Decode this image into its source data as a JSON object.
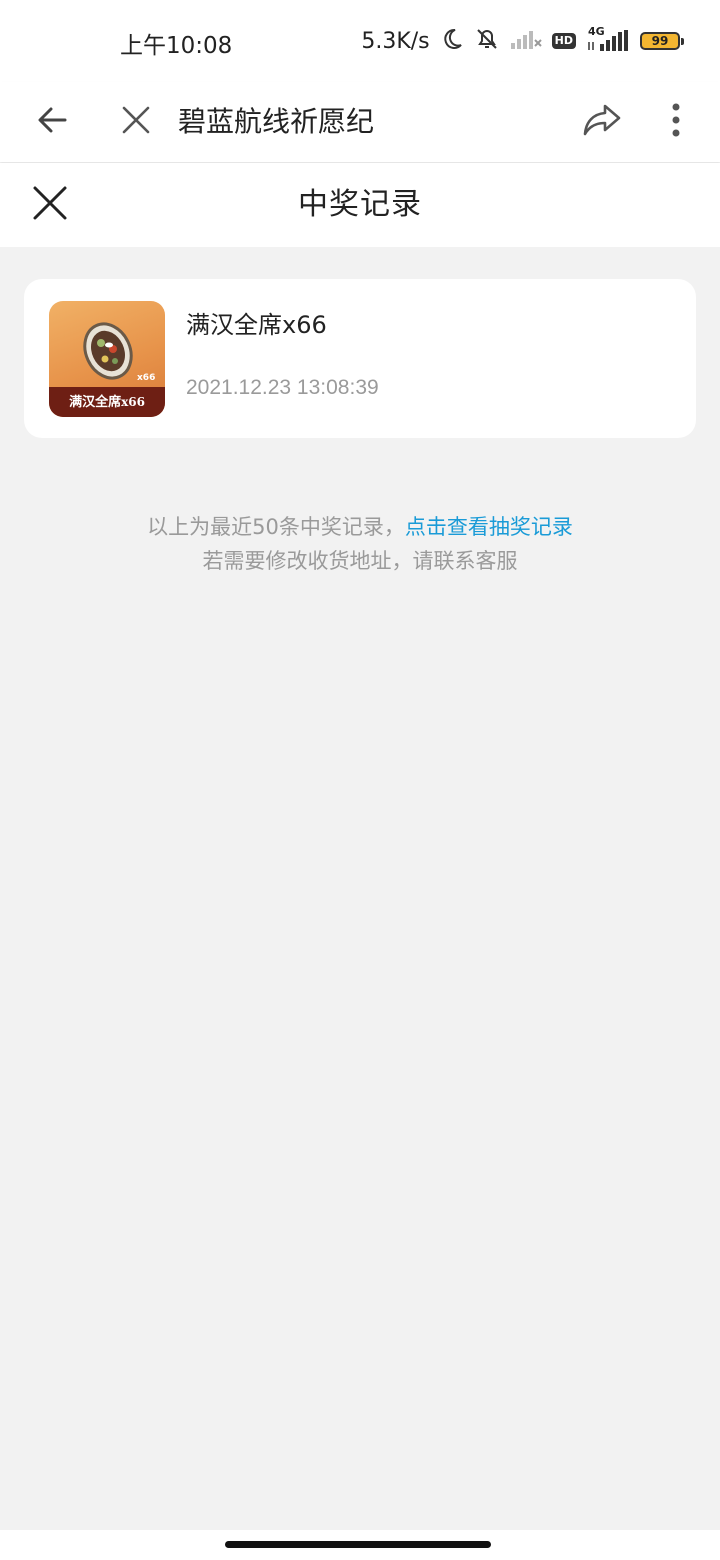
{
  "status_bar": {
    "time": "上午10:08",
    "net_speed": "5.3K/s",
    "network_type": "4G",
    "hd_label": "HD",
    "battery": "99",
    "icons": [
      "moon-icon",
      "mute-bell-icon",
      "wifi-signal-icon",
      "hd-icon",
      "cell-signal-icon",
      "battery-icon"
    ]
  },
  "browser": {
    "title": "碧蓝航线祈愿纪",
    "icons": [
      "back-arrow-icon",
      "close-icon",
      "share-icon",
      "more-vertical-icon"
    ]
  },
  "modal": {
    "title": "中奖记录"
  },
  "records": [
    {
      "prize_name": "满汉全席x66",
      "time": "2021.12.23 13:08:39",
      "thumb_label": "满汉全席",
      "thumb_count": "x66",
      "thumb_label_count": "x66"
    }
  ],
  "notice": {
    "text": "以上为最近50条中奖记录，",
    "link": "点击查看抽奖记录",
    "line2": "若需要修改收货地址，请联系客服"
  },
  "colors": {
    "link": "#1a9bd7",
    "background": "#f2f2f2",
    "card": "#ffffff",
    "thumb_orange": "#e7934a",
    "thumb_label_bg": "#6e1f14"
  }
}
